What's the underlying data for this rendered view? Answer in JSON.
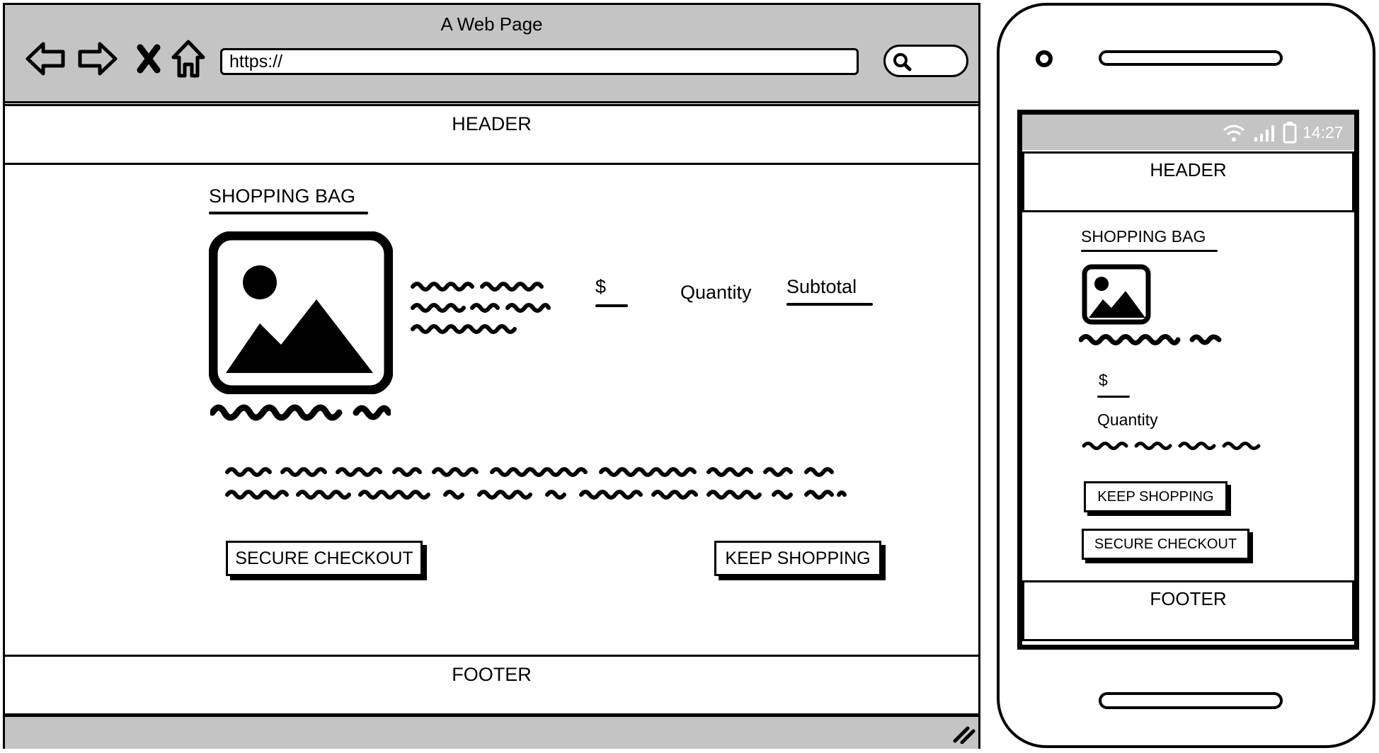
{
  "browser": {
    "window_title": "A Web Page",
    "url": "https://",
    "nav_icons": [
      "back-arrow-icon",
      "forward-arrow-icon",
      "close-icon",
      "home-icon",
      "search-icon",
      "resize-grip-icon"
    ]
  },
  "desktop": {
    "header_label": "HEADER",
    "shopping_bag_title": "SHOPPING BAG",
    "price_symbol": "$",
    "quantity_label": "Quantity",
    "subtotal_label": "Subtotal",
    "secure_checkout_label": "SECURE CHECKOUT",
    "keep_shopping_label": "KEEP SHOPPING",
    "footer_label": "FOOTER"
  },
  "mobile": {
    "status_time": "14:27",
    "status_icons": [
      "wifi-icon",
      "signal-icon",
      "battery-icon"
    ],
    "header_label": "HEADER",
    "shopping_bag_title": "SHOPPING BAG",
    "price_symbol": "$",
    "quantity_label": "Quantity",
    "keep_shopping_label": "KEEP SHOPPING",
    "secure_checkout_label": "SECURE CHECKOUT",
    "footer_label": "FOOTER"
  },
  "colors": {
    "chrome_gray": "#c4c4c4",
    "ink": "#000000",
    "paper": "#ffffff"
  }
}
